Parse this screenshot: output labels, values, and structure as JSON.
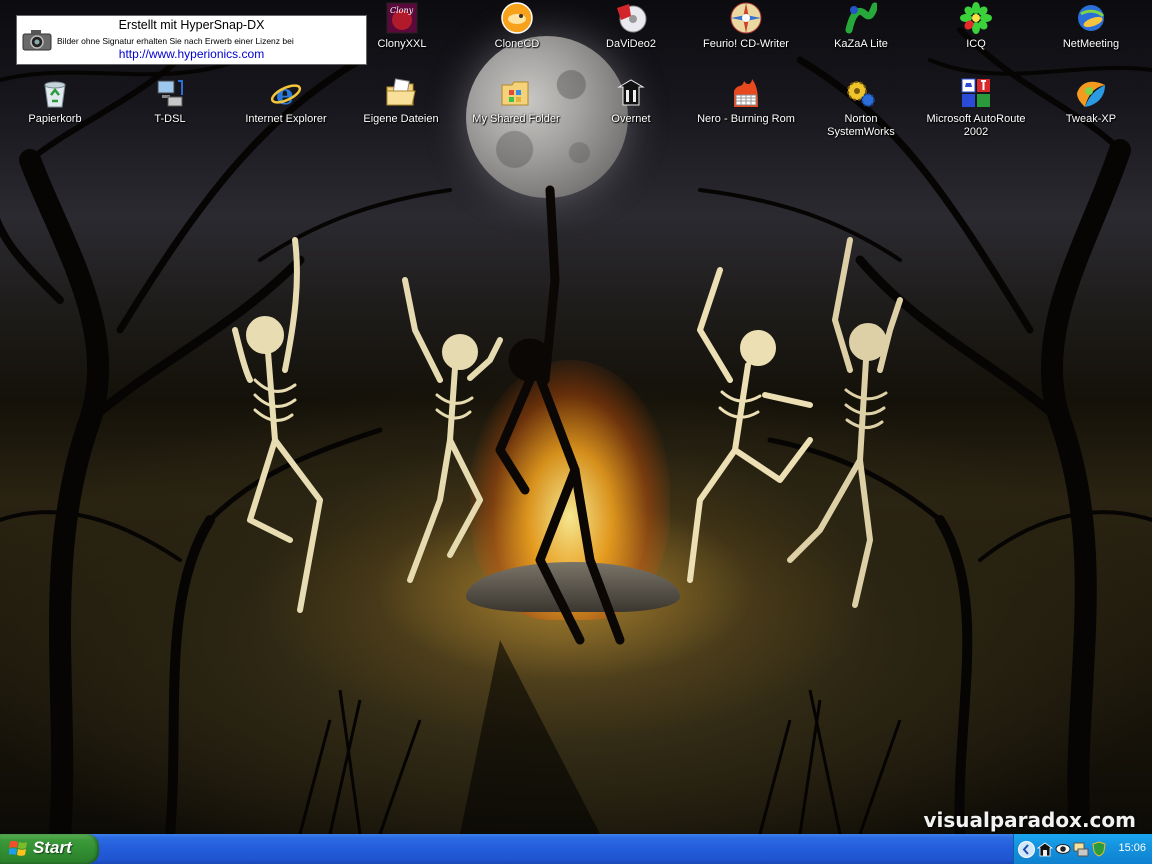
{
  "hypersnap": {
    "title": "Erstellt mit HyperSnap-DX",
    "notice": "Bilder ohne Signatur erhalten Sie nach Erwerb einer Lizenz bei",
    "url": "http://www.hyperionics.com"
  },
  "desktop": {
    "row1": [
      {
        "label": "ClonyXXL",
        "icon": "clony-icon"
      },
      {
        "label": "CloneCD",
        "icon": "clonecd-icon"
      },
      {
        "label": "DaViDeo2",
        "icon": "davideo-icon"
      },
      {
        "label": "Feurio! CD-Writer",
        "icon": "feurio-icon"
      },
      {
        "label": "KaZaA Lite",
        "icon": "kazaa-icon"
      },
      {
        "label": "ICQ",
        "icon": "icq-flower-icon"
      },
      {
        "label": "NetMeeting",
        "icon": "netmeeting-icon"
      }
    ],
    "row2": [
      {
        "label": "Papierkorb",
        "icon": "recycle-bin-icon"
      },
      {
        "label": "T-DSL",
        "icon": "network-computer-icon"
      },
      {
        "label": "Internet Explorer",
        "icon": "internet-explorer-icon"
      },
      {
        "label": "Eigene Dateien",
        "icon": "my-documents-folder-icon"
      },
      {
        "label": "My Shared Folder",
        "icon": "shared-folder-icon"
      },
      {
        "label": "Overnet",
        "icon": "overnet-icon"
      },
      {
        "label": "Nero - Burning Rom",
        "icon": "nero-icon"
      },
      {
        "label": "Norton SystemWorks",
        "icon": "norton-icon"
      },
      {
        "label": "Microsoft AutoRoute 2002",
        "icon": "autoroute-icon"
      },
      {
        "label": "Tweak-XP",
        "icon": "tweak-xp-icon"
      }
    ]
  },
  "wallpaper": {
    "watermark": "visualparadox.com"
  },
  "taskbar": {
    "start_label": "Start",
    "clock": "15:06",
    "tray_icons": [
      "show-hidden-icons-chevron",
      "tray-app-icon",
      "tray-eye-icon",
      "tray-network-icon",
      "tray-shield-icon"
    ]
  },
  "colors": {
    "taskbar_blue": "#245edb",
    "start_green": "#3c9a3a",
    "tray_blue": "#1593df",
    "link_blue": "#0000cc"
  }
}
